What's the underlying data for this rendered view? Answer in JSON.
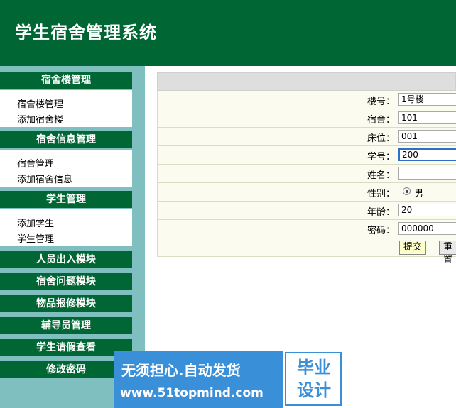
{
  "app": {
    "title": "学生宿舍管理系统"
  },
  "sidebar": {
    "sections": [
      {
        "header": "宿舍楼管理",
        "items": [
          "宿舍楼管理",
          "添加宿舍楼"
        ]
      },
      {
        "header": "宿舍信息管理",
        "items": [
          "宿舍管理",
          "添加宿舍信息"
        ]
      },
      {
        "header": "学生管理",
        "items": [
          "添加学生",
          "学生管理"
        ]
      }
    ],
    "menu": [
      "人员出入模块",
      "宿舍问题模块",
      "物品报修模块",
      "辅导员管理",
      "学生请假查看",
      "修改密码"
    ]
  },
  "form": {
    "building": {
      "label": "楼号：",
      "value": "1号楼"
    },
    "dorm": {
      "label": "宿舍：",
      "value": "101"
    },
    "bed": {
      "label": "床位：",
      "value": "001"
    },
    "student_no": {
      "label": "学号：",
      "value": "200"
    },
    "name": {
      "label": "姓名：",
      "value": ""
    },
    "gender": {
      "label": "性别：",
      "value": "男"
    },
    "age": {
      "label": "年龄：",
      "value": "20"
    },
    "password": {
      "label": "密码：",
      "value": "000000"
    },
    "submit_label": "提交",
    "reset_label": "重置"
  },
  "ad": {
    "slogan": "无须担心.自动发货",
    "url": "www.51topmind.com",
    "badge_line1": "毕业",
    "badge_line2": "设计"
  }
}
